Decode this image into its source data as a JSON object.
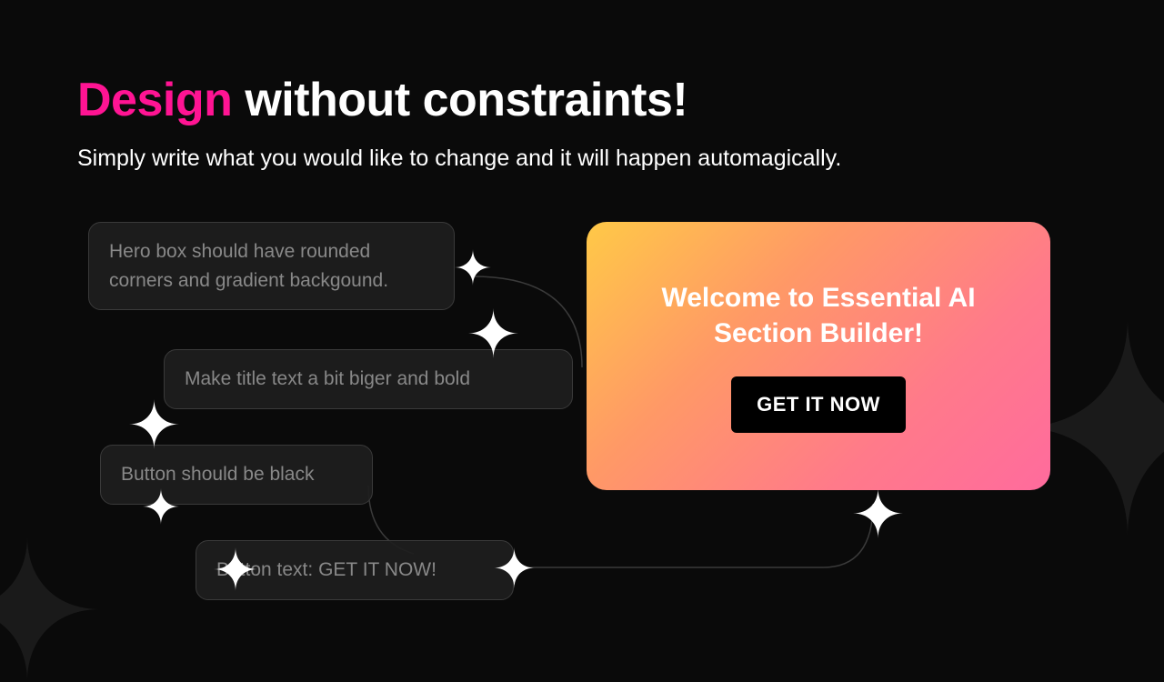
{
  "headline": {
    "accent": "Design",
    "rest": " without constraints!"
  },
  "subtitle": "Simply write what you would like to change and it will happen automagically.",
  "prompts": [
    "Hero box should have rounded corners and gradient backgound.",
    "Make title text a bit biger and bold",
    "Button should be black",
    "Button text: GET IT NOW!"
  ],
  "preview": {
    "title": "Welcome to Essential AI Section Builder!",
    "button_label": "GET IT NOW"
  },
  "colors": {
    "accent": "#ff1493",
    "gradient_start": "#ffc947",
    "gradient_end": "#ff6b9d"
  }
}
